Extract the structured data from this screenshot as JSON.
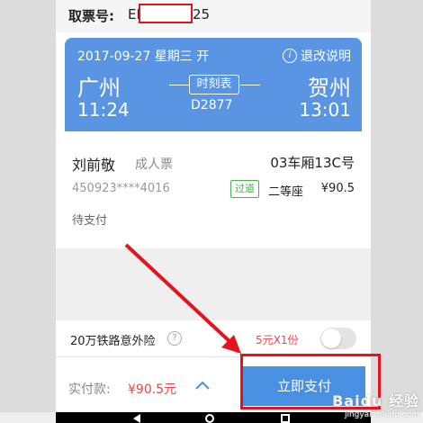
{
  "order": {
    "label": "取票号:",
    "visible_prefix": "EE",
    "visible_suffix": "25"
  },
  "ticket": {
    "date_line": "2017-09-27 星期三 开",
    "refund_label": "退改说明",
    "from_city": "广州",
    "to_city": "贺州",
    "depart_time": "11:24",
    "arrive_time": "13:01",
    "timetable_label": "时刻表",
    "train_number": "D2877"
  },
  "passenger": {
    "name": "刘前敬",
    "ticket_type": "成人票",
    "seat": "03车厢13C号",
    "id_number": "450923****4016",
    "status_tag": "过道",
    "seat_class": "二等座",
    "price": "¥90.5",
    "pay_status": "待支付"
  },
  "insurance": {
    "label": "20万铁路意外险",
    "help_glyph": "?",
    "quantity": "5元X1份",
    "enabled": false
  },
  "payment": {
    "label": "实付款:",
    "amount": "¥90.5元",
    "button_label": "立即支付"
  },
  "watermark": {
    "brand": "Baidu 经验",
    "sub": "jingyan.baidu.com"
  },
  "colors": {
    "ticket_header": "#5a95e3",
    "pay_button": "#4a90e2",
    "price_red": "#e44444",
    "annotation_red": "#e3141b",
    "tag_green": "#4caf50"
  }
}
